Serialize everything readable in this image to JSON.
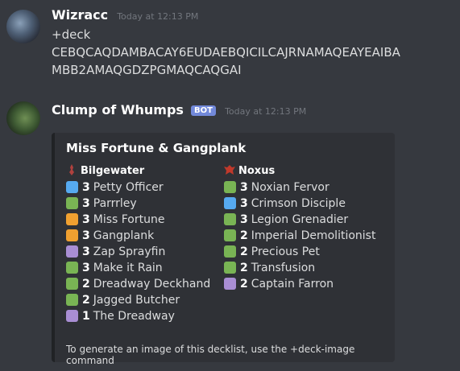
{
  "messages": [
    {
      "username": "Wizracc",
      "timestamp": "Today at 12:13 PM",
      "lines": [
        "+deck",
        "CEBQCAQDAMBACAY6EUDAEBQICILCAJRNAMAQEAYEAIBA",
        "MBB2AMAQGDZPGMAQCAQGAI"
      ]
    },
    {
      "username": "Clump of Whumps",
      "badge": "BOT",
      "timestamp": "Today at 12:13 PM"
    }
  ],
  "embed": {
    "title": "Miss Fortune & Gangplank",
    "regions": [
      {
        "name": "Bilgewater",
        "icon": "bilgewater-icon",
        "icon_color": "#b0413e",
        "cards": [
          {
            "count": "3",
            "name": "Petty Officer",
            "color": "#56aaf0"
          },
          {
            "count": "3",
            "name": "Parrrley",
            "color": "#79b454"
          },
          {
            "count": "3",
            "name": "Miss Fortune",
            "color": "#f0a030"
          },
          {
            "count": "3",
            "name": "Gangplank",
            "color": "#f0a030"
          },
          {
            "count": "3",
            "name": "Zap Sprayfin",
            "color": "#a98ed4"
          },
          {
            "count": "3",
            "name": "Make it Rain",
            "color": "#79b454"
          },
          {
            "count": "2",
            "name": "Dreadway Deckhand",
            "color": "#79b454"
          },
          {
            "count": "2",
            "name": "Jagged Butcher",
            "color": "#79b454"
          },
          {
            "count": "1",
            "name": "The Dreadway",
            "color": "#a98ed4"
          }
        ]
      },
      {
        "name": "Noxus",
        "icon": "noxus-icon",
        "icon_color": "#c0392b",
        "cards": [
          {
            "count": "3",
            "name": "Noxian Fervor",
            "color": "#79b454"
          },
          {
            "count": "3",
            "name": "Crimson Disciple",
            "color": "#56aaf0"
          },
          {
            "count": "3",
            "name": "Legion Grenadier",
            "color": "#79b454"
          },
          {
            "count": "2",
            "name": "Imperial Demolitionist",
            "color": "#79b454"
          },
          {
            "count": "2",
            "name": "Precious Pet",
            "color": "#79b454"
          },
          {
            "count": "2",
            "name": "Transfusion",
            "color": "#79b454"
          },
          {
            "count": "2",
            "name": "Captain Farron",
            "color": "#a98ed4"
          }
        ]
      }
    ],
    "footer": "To generate an image of this decklist, use the +deck-image command"
  }
}
